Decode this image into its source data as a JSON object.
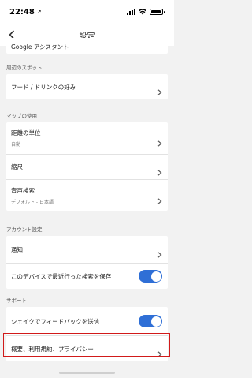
{
  "status_bar": {
    "time": "22:48",
    "battery_level": 0.9
  },
  "header": {
    "title": "設定"
  },
  "top_card": {
    "label": "Google アシスタント"
  },
  "sections": [
    {
      "label": "周辺のスポット",
      "items": [
        {
          "label": "フード / ドリンクの好み",
          "control": "chevron"
        }
      ]
    },
    {
      "label": "マップの使用",
      "items": [
        {
          "label": "距離の単位",
          "sub": "自動",
          "control": "chevron"
        },
        {
          "label": "縮尺",
          "control": "chevron"
        },
        {
          "label": "音声検索",
          "sub": "デフォルト - 日本語",
          "control": "chevron"
        }
      ]
    },
    {
      "label": "アカウント設定",
      "items": [
        {
          "label": "通知",
          "control": "chevron"
        },
        {
          "label": "このデバイスで最近行った検索を保存",
          "control": "toggle",
          "on": true
        }
      ]
    },
    {
      "label": "サポート",
      "items": [
        {
          "label": "シェイクでフィードバックを送信",
          "control": "toggle",
          "on": true
        },
        {
          "label": "概要、利用規約、プライバシー",
          "control": "chevron"
        }
      ]
    }
  ],
  "colors": {
    "toggle_on": "#2f6fd6",
    "highlight_border": "#d11a1a"
  }
}
